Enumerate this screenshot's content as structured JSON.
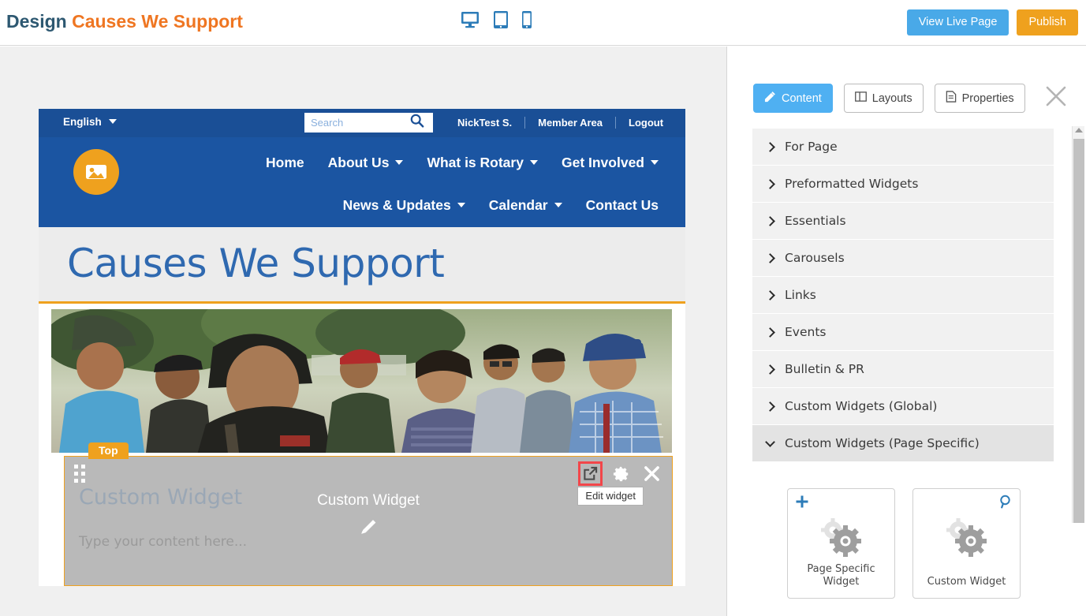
{
  "topbar": {
    "title_prefix": "Design",
    "title_page": "Causes We Support",
    "devices": [
      {
        "name": "desktop-view-icon",
        "label": "Desktop"
      },
      {
        "name": "tablet-view-icon",
        "label": "Tablet"
      },
      {
        "name": "mobile-view-icon",
        "label": "Mobile"
      }
    ],
    "view_live_label": "View Live Page",
    "publish_label": "Publish",
    "accent_orange": "#ef7622",
    "title_blue": "#2d5871",
    "view_live_color": "#49a9e8",
    "publish_color": "#efa11e"
  },
  "site": {
    "utility": {
      "language": "English",
      "search_placeholder": "Search",
      "search_value": "",
      "links": [
        "NickTest S.",
        "Member Area",
        "Logout"
      ]
    },
    "nav": {
      "row1": [
        {
          "label": "Home",
          "caret": false
        },
        {
          "label": "About Us",
          "caret": true
        },
        {
          "label": "What is Rotary",
          "caret": true
        },
        {
          "label": "Get Involved",
          "caret": true
        }
      ],
      "row2": [
        {
          "label": "News & Updates",
          "caret": true
        },
        {
          "label": "Calendar",
          "caret": true
        },
        {
          "label": "Contact Us",
          "caret": false
        }
      ],
      "bar_color": "#1b55a2",
      "utility_color": "#1a4f96",
      "logo_color": "#efa11e"
    },
    "heading": "Causes We Support",
    "heading_color": "#2f69b0",
    "heading_underline": "#efa11e"
  },
  "widget_region": {
    "top_tab_label": "Top",
    "tools": [
      {
        "name": "edit-widget-icon",
        "highlighted": true
      },
      {
        "name": "widget-settings-gear-icon",
        "highlighted": false
      },
      {
        "name": "remove-widget-icon",
        "highlighted": false
      }
    ],
    "tooltip": "Edit widget",
    "widget_title": "Custom Widget",
    "content_placeholder": "Type your content here...",
    "overlay_label": "Custom Widget",
    "border_color": "#efa11e",
    "highlight_color": "#f2464a"
  },
  "right_panel": {
    "tabs": [
      {
        "label": "Content",
        "icon": "content-edit-icon",
        "active": true
      },
      {
        "label": "Layouts",
        "icon": "layouts-columns-icon",
        "active": false
      },
      {
        "label": "Properties",
        "icon": "properties-document-icon",
        "active": false
      }
    ],
    "close_label": "Close panel",
    "accordion": [
      {
        "label": "For Page",
        "open": false
      },
      {
        "label": "Preformatted Widgets",
        "open": false
      },
      {
        "label": "Essentials",
        "open": false
      },
      {
        "label": "Carousels",
        "open": false
      },
      {
        "label": "Links",
        "open": false
      },
      {
        "label": "Events",
        "open": false
      },
      {
        "label": "Bulletin & PR",
        "open": false
      },
      {
        "label": "Custom Widgets (Global)",
        "open": false
      },
      {
        "label": "Custom Widgets (Page Specific)",
        "open": true
      }
    ],
    "widget_cards": [
      {
        "label": "Page Specific Widget",
        "corner_icon": "plus-icon",
        "corner_side": "left"
      },
      {
        "label": "Custom Widget",
        "corner_icon": "search-icon",
        "corner_side": "right"
      }
    ],
    "active_tab_color": "#4fb0f2"
  }
}
